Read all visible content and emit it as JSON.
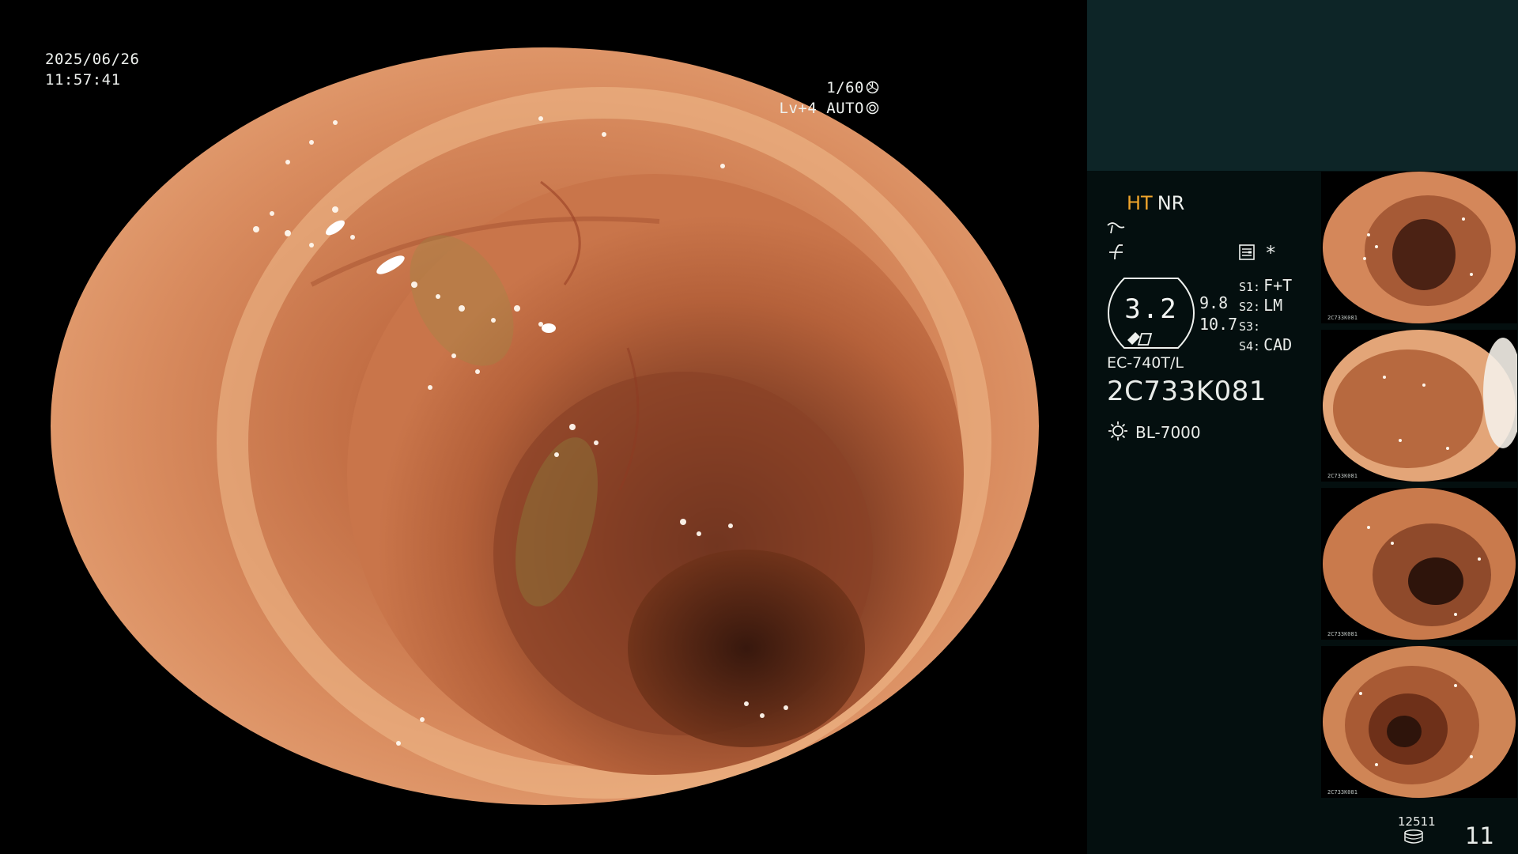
{
  "overlay": {
    "date": "2025/06/26",
    "time": "11:57:41",
    "shutter": "1/60",
    "iris": "Lv+4 AUTO",
    "shutter_icon": "aperture-icon",
    "iris_icon": "iris-auto-icon"
  },
  "panel": {
    "mode_ht": "HT",
    "mode_nr": "NR",
    "enhance_icon": "contrast-curve-icon",
    "gamma_icon": "gamma-icon",
    "memo_icon": "notepad-icon",
    "asterisk": "*",
    "zoom": "3.2",
    "zoom_val_a": "9.8",
    "zoom_val_b": "10.7",
    "switches": [
      {
        "key": "S1:",
        "value": "F+T"
      },
      {
        "key": "S2:",
        "value": "LM"
      },
      {
        "key": "S3:",
        "value": ""
      },
      {
        "key": "S4:",
        "value": "CAD"
      }
    ],
    "scope_model": "EC-740T/L",
    "serial": "2C733K081",
    "light_source": "BL-7000",
    "light_icon": "lamp-icon",
    "storage_count": "12511",
    "storage_icon": "database-icon",
    "image_count": "11",
    "colors": {
      "accent": "#f0a52b",
      "panel_top": "#0d2527",
      "panel": "#040f0f"
    }
  },
  "thumbnails": [
    {
      "caption": "2C733K081"
    },
    {
      "caption": "2C733K081"
    },
    {
      "caption": "2C733K081"
    },
    {
      "caption": "2C733K081"
    }
  ]
}
